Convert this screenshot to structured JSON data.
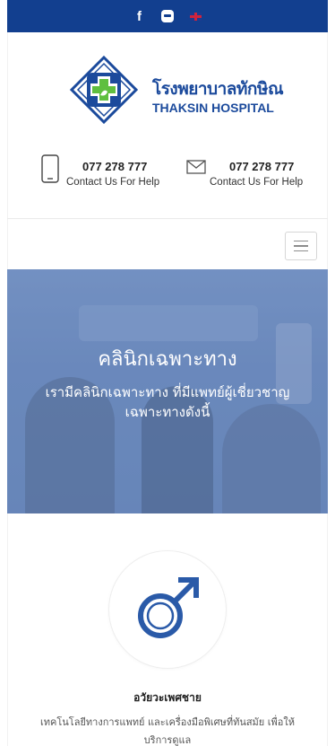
{
  "topbar": {
    "facebook_glyph": "f",
    "icons": [
      "facebook-icon",
      "line-icon",
      "uk-flag-icon"
    ],
    "background": "#123f8f"
  },
  "brand": {
    "name_th": "โรงพยาบาลทักษิณ",
    "name_en": "THAKSIN HOSPITAL",
    "primary_color": "#1b4a9c",
    "accent_green": "#5fbf3f"
  },
  "contacts": [
    {
      "icon": "phone-icon",
      "number": "077 278 777",
      "label": "Contact Us For Help"
    },
    {
      "icon": "mail-icon",
      "number": "077 278 777",
      "label": "Contact Us For Help"
    }
  ],
  "nav": {
    "menu_icon": "hamburger-menu-icon"
  },
  "hero": {
    "title": "คลินิกเฉพาะทาง",
    "subtitle": "เรามีคลินิกเฉพาะทาง ที่มีแพทย์ผู้เชี่ยวชาญเฉพาะทางดังนี้"
  },
  "service": {
    "icon": "male-symbol-icon",
    "title": "อวัยวะเพศชาย",
    "description": "เทคโนโลยีทางการแพทย์ และเครื่องมือพิเศษที่ทันสมัย เพื่อให้บริการดูแล"
  }
}
